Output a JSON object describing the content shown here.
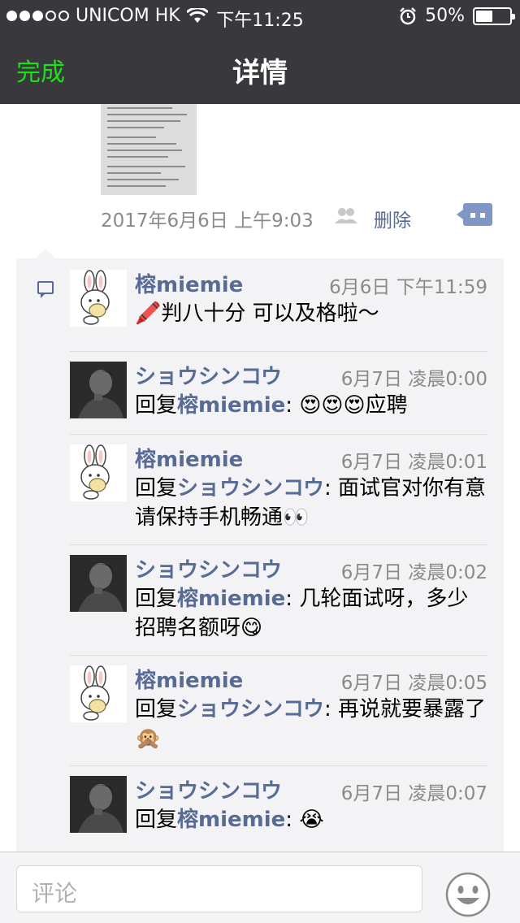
{
  "status_bar": {
    "carrier": "UNICOM HK",
    "time": "下午11:25",
    "battery": "50%",
    "battery_level": 0.5,
    "signal_bars": 3,
    "signal_total": 5
  },
  "nav": {
    "done_label": "完成",
    "title": "详情"
  },
  "post": {
    "timestamp": "2017年6月6日 上午9:03",
    "delete_label": "删除"
  },
  "comments": [
    {
      "author": "榕miemie",
      "avatar": "bunny-avatar",
      "time": "6月6日 下午11:59",
      "reply_prefix": "",
      "reply_to": "",
      "text": "🖍️判八十分 可以及格啦～"
    },
    {
      "author": "ショウシンコウ",
      "avatar": "man-avatar",
      "time": "6月7日 凌晨0:00",
      "reply_prefix": "回复",
      "reply_to": "榕miemie",
      "text": ": 😍😍😍应聘"
    },
    {
      "author": "榕miemie",
      "avatar": "bunny-avatar",
      "time": "6月7日 凌晨0:01",
      "reply_prefix": "回复",
      "reply_to": "ショウシンコウ",
      "text": ": 面试官对你有意 请保持手机畅通👀"
    },
    {
      "author": "ショウシンコウ",
      "avatar": "man-avatar",
      "time": "6月7日 凌晨0:02",
      "reply_prefix": "回复",
      "reply_to": "榕miemie",
      "text": ": 几轮面试呀，多少招聘名额呀😋"
    },
    {
      "author": "榕miemie",
      "avatar": "bunny-avatar",
      "time": "6月7日 凌晨0:05",
      "reply_prefix": "回复",
      "reply_to": "ショウシンコウ",
      "text": ": 再说就要暴露了🙊"
    },
    {
      "author": "ショウシンコウ",
      "avatar": "man-avatar",
      "time": "6月7日 凌晨0:07",
      "reply_prefix": "回复",
      "reply_to": "榕miemie",
      "text": ": 😭"
    }
  ],
  "input": {
    "placeholder": "评论"
  },
  "colors": {
    "nav_bg": "#39393d",
    "done": "#1ee017",
    "link": "#576b95",
    "comments_bg": "#f3f3f5"
  }
}
